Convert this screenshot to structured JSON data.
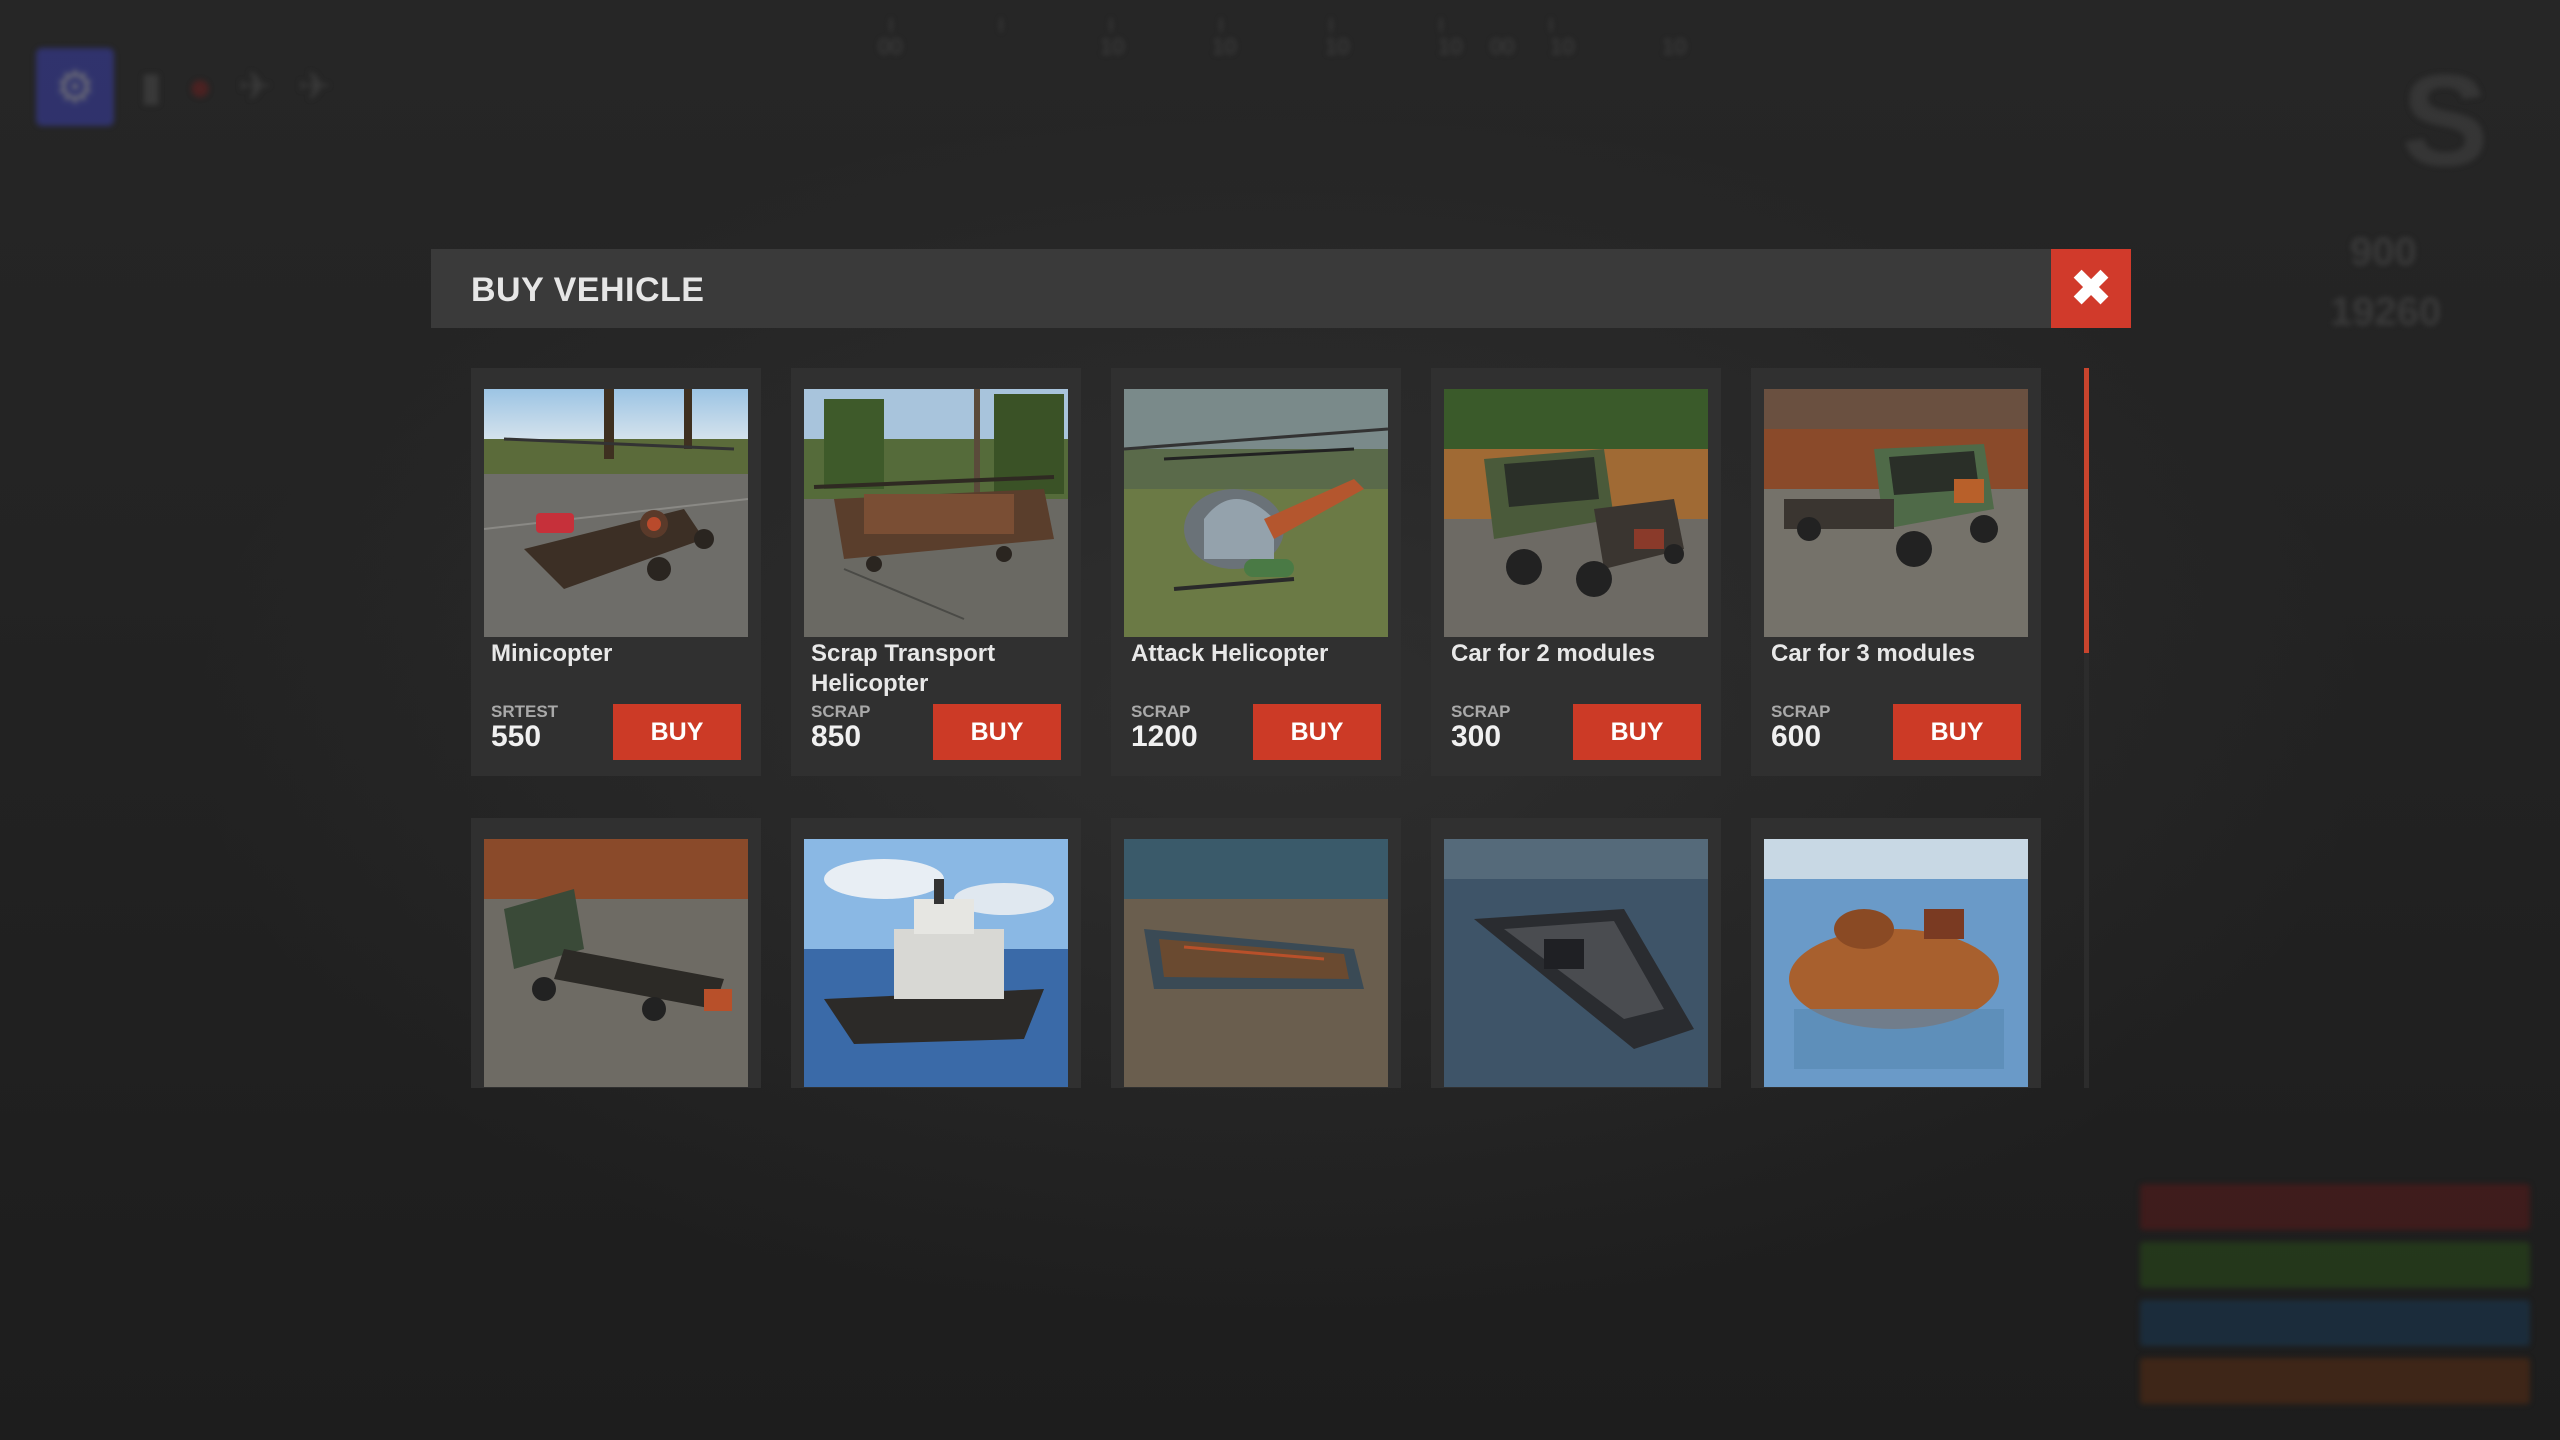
{
  "modal": {
    "title": "BUY VEHICLE",
    "close_icon": "close-x-icon"
  },
  "vehicles": [
    {
      "name": "Minicopter",
      "currency": "SRTEST",
      "price": "550",
      "buy_label": "BUY",
      "image": "minicopter"
    },
    {
      "name": "Scrap Transport Helicopter",
      "currency": "SCRAP",
      "price": "850",
      "buy_label": "BUY",
      "image": "scrap-transport-helicopter"
    },
    {
      "name": "Attack Helicopter",
      "currency": "SCRAP",
      "price": "1200",
      "buy_label": "BUY",
      "image": "attack-helicopter"
    },
    {
      "name": "Car for 2 modules",
      "currency": "SCRAP",
      "price": "300",
      "buy_label": "BUY",
      "image": "car-2-modules"
    },
    {
      "name": "Car for 3 modules",
      "currency": "SCRAP",
      "price": "600",
      "buy_label": "BUY",
      "image": "car-3-modules"
    }
  ],
  "vehicles_row2_images": [
    "car-chassis",
    "tugboat",
    "rowboat",
    "rhib",
    "submarine"
  ],
  "scrollbar": {
    "position": 0.0
  },
  "colors": {
    "accent_red": "#cc3a26",
    "close_red": "#d13a2b",
    "header_bg": "#3a3a3a",
    "card_bg": "#303030",
    "scroll_thumb": "#c8442d"
  },
  "background_hud": {
    "compass_labels": [
      "00",
      "10",
      "10",
      "10",
      "10",
      "00",
      "10",
      "10"
    ],
    "right_values": [
      "900",
      "19260"
    ]
  }
}
